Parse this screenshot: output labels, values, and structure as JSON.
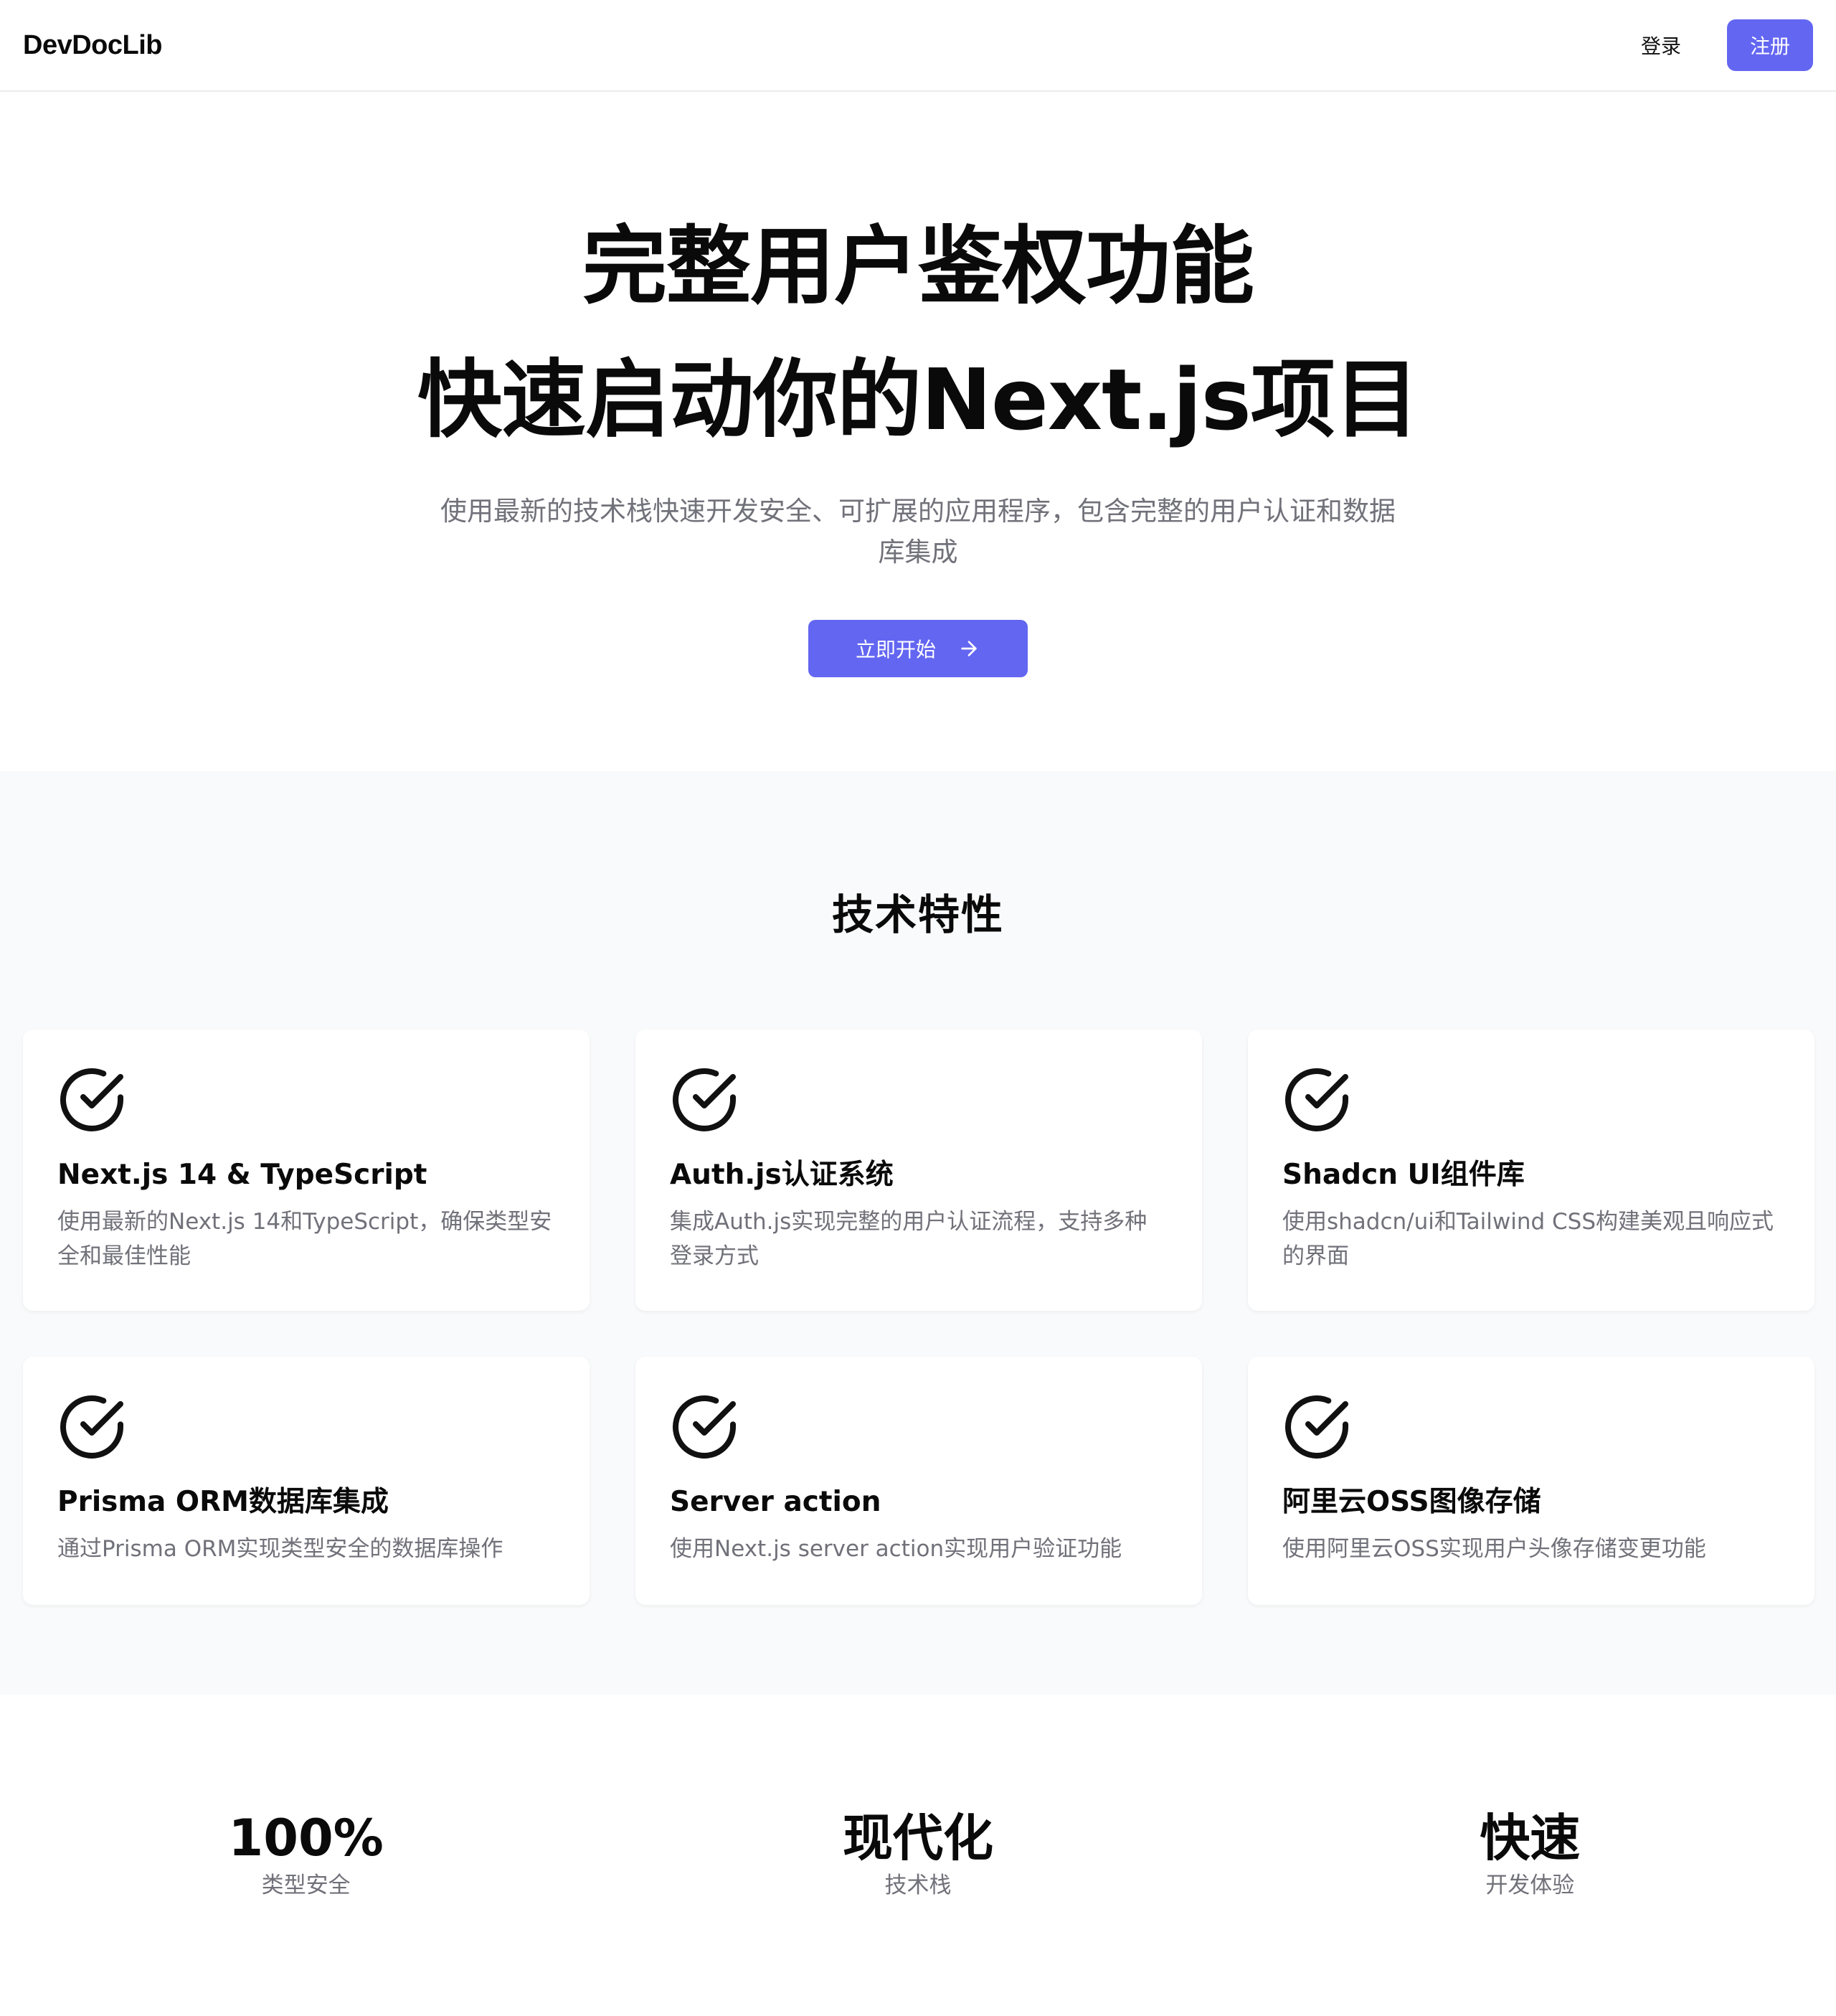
{
  "navbar": {
    "brand": "DevDocLib",
    "login_label": "登录",
    "signup_label": "注册"
  },
  "hero": {
    "title_line1": "完整用户鉴权功能",
    "title_line2": "快速启动你的Next.js项目",
    "subtitle": "使用最新的技术栈快速开发安全、可扩展的应用程序，包含完整的用户认证和数据库集成",
    "cta_label": "立即开始"
  },
  "features": {
    "title": "技术特性",
    "items": [
      {
        "title": "Next.js 14 & TypeScript",
        "desc": "使用最新的Next.js 14和TypeScript，确保类型安全和最佳性能",
        "icon": "check-circle-icon"
      },
      {
        "title": "Auth.js认证系统",
        "desc": "集成Auth.js实现完整的用户认证流程，支持多种登录方式",
        "icon": "check-circle-icon"
      },
      {
        "title": "Shadcn UI组件库",
        "desc": "使用shadcn/ui和Tailwind CSS构建美观且响应式的界面",
        "icon": "check-circle-icon"
      },
      {
        "title": "Prisma ORM数据库集成",
        "desc": "通过Prisma ORM实现类型安全的数据库操作",
        "icon": "check-circle-icon"
      },
      {
        "title": "Server action",
        "desc": "使用Next.js server action实现用户验证功能",
        "icon": "check-circle-icon"
      },
      {
        "title": "阿里云OSS图像存储",
        "desc": "使用阿里云OSS实现用户头像存储变更功能",
        "icon": "check-circle-icon"
      }
    ]
  },
  "stats": [
    {
      "value": "100%",
      "label": "类型安全"
    },
    {
      "value": "现代化",
      "label": "技术栈"
    },
    {
      "value": "快速",
      "label": "开发体验"
    }
  ],
  "colors": {
    "accent": "#6366f1",
    "muted_text": "#71717a",
    "section_bg": "#f9fafb"
  }
}
